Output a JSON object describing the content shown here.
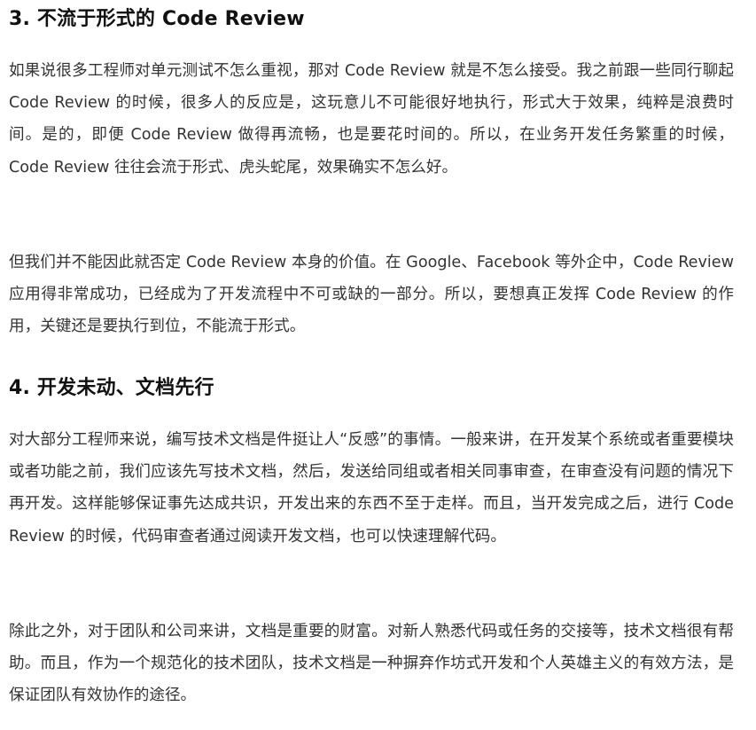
{
  "sections": [
    {
      "title": "3. 不流于形式的 Code Review",
      "paragraphs": [
        "如果说很多工程师对单元测试不怎么重视，那对 Code Review 就是不怎么接受。我之前跟一些同行聊起 Code Review 的时候，很多人的反应是，这玩意儿不可能很好地执行，形式大于效果，纯粹是浪费时间。是的，即便 Code Review 做得再流畅，也是要花时间的。所以，在业务开发任务繁重的时候，Code Review 往往会流于形式、虎头蛇尾，效果确实不怎么好。",
        "但我们并不能因此就否定 Code Review 本身的价值。在 Google、Facebook 等外企中，Code Review 应用得非常成功，已经成为了开发流程中不可或缺的一部分。所以，要想真正发挥 Code Review 的作用，关键还是要执行到位，不能流于形式。"
      ]
    },
    {
      "title": "4. 开发未动、文档先行",
      "paragraphs": [
        "对大部分工程师来说，编写技术文档是件挺让人“反感”的事情。一般来讲，在开发某个系统或者重要模块或者功能之前，我们应该先写技术文档，然后，发送给同组或者相关同事审查，在审查没有问题的情况下再开发。这样能够保证事先达成共识，开发出来的东西不至于走样。而且，当开发完成之后，进行 Code Review 的时候，代码审查者通过阅读开发文档，也可以快速理解代码。",
        "除此之外，对于团队和公司来讲，文档是重要的财富。对新人熟悉代码或任务的交接等，技术文档很有帮助。而且，作为一个规范化的技术团队，技术文档是一种摒弃作坊式开发和个人英雄主义的有效方法，是保证团队有效协作的途径。"
      ]
    }
  ]
}
